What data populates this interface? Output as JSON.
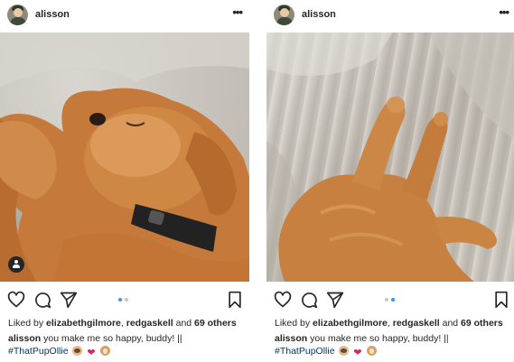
{
  "posts": [
    {
      "username": "alisson",
      "more_label": "•••",
      "liked_by_prefix": "Liked by ",
      "liked_user_1": "elizabethgilmore",
      "liked_sep": ", ",
      "liked_user_2": "redgaskell",
      "liked_and": " and ",
      "liked_others": "69 others",
      "caption_user": "alisson",
      "caption_text": " you make me so happy, buddy! ||",
      "hashtag": "#ThatPupOllie",
      "heart_glyph": "❤",
      "carousel_active_index": 1,
      "carousel_count": 2
    },
    {
      "username": "alisson",
      "more_label": "•••",
      "liked_by_prefix": "Liked by ",
      "liked_user_1": "elizabethgilmore",
      "liked_sep": ", ",
      "liked_user_2": "redgaskell",
      "liked_and": " and ",
      "liked_others": "69 others",
      "caption_user": "alisson",
      "caption_text": " you make me so happy, buddy! ||",
      "hashtag": "#ThatPupOllie",
      "heart_glyph": "❤",
      "carousel_active_index": 2,
      "carousel_count": 2
    }
  ],
  "icons": {
    "avatar": "avatar-icon",
    "more": "more-options-icon",
    "like": "heart-outline-icon",
    "comment": "comment-bubble-icon",
    "share": "paper-plane-icon",
    "bookmark": "bookmark-icon",
    "tag": "tagged-person-icon"
  },
  "colors": {
    "text": "#262626",
    "hashtag": "#00376b",
    "carousel_active": "#3897f0",
    "carousel_inactive": "#c7c7c7",
    "heart_emoji": "#e0245e"
  }
}
